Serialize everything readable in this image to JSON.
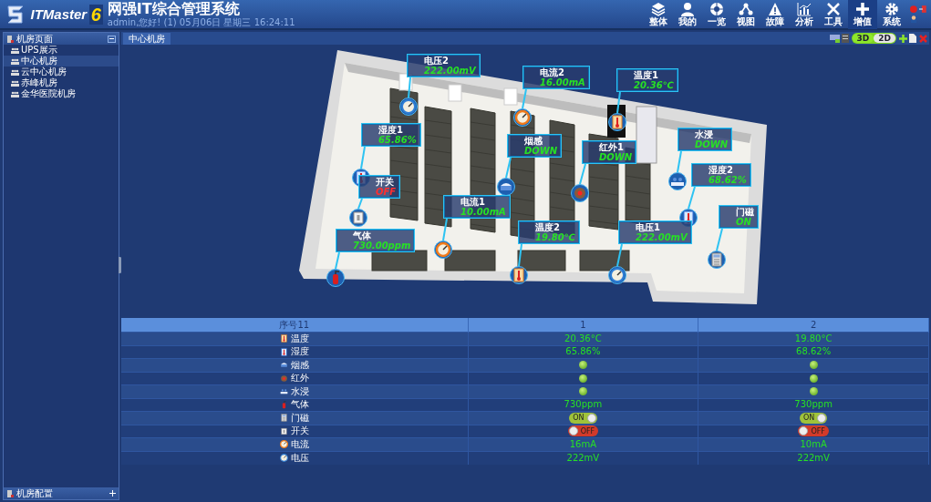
{
  "app": {
    "logo_text": "ITMaster",
    "logo_version": "6",
    "title": "网强IT综合管理系统",
    "user_line": "admin,您好! (1) 05月06日 星期三 16:24:11"
  },
  "nav": [
    {
      "label": "整体",
      "selected": false
    },
    {
      "label": "我的",
      "selected": false
    },
    {
      "label": "一览",
      "selected": false
    },
    {
      "label": "视图",
      "selected": false
    },
    {
      "label": "故障",
      "selected": false
    },
    {
      "label": "分析",
      "selected": false
    },
    {
      "label": "工具",
      "selected": false
    },
    {
      "label": "增值",
      "selected": true
    },
    {
      "label": "系统",
      "selected": false
    }
  ],
  "sidebar": {
    "title": "机房页面",
    "items": [
      {
        "label": "UPS展示",
        "selected": false
      },
      {
        "label": "中心机房",
        "selected": true
      },
      {
        "label": "云中心机房",
        "selected": false
      },
      {
        "label": "赤峰机房",
        "selected": false
      },
      {
        "label": "金华医院机房",
        "selected": false
      }
    ],
    "footer": "机房配置"
  },
  "tabs": [
    {
      "label": "中心机房",
      "selected": true
    }
  ],
  "view_toggle": [
    {
      "label": "3D",
      "selected": true
    },
    {
      "label": "2D",
      "selected": false
    }
  ],
  "sensors": [
    {
      "kind": "voltage",
      "name": "电压2",
      "value": "222.00mV",
      "alarm": false
    },
    {
      "kind": "current",
      "name": "电流2",
      "value": "16.00mA",
      "alarm": false
    },
    {
      "kind": "temperature",
      "name": "温度1",
      "value": "20.36℃",
      "alarm": false
    },
    {
      "kind": "humidity",
      "name": "湿度1",
      "value": "65.86%",
      "alarm": false
    },
    {
      "kind": "smoke",
      "name": "烟感",
      "value": "DOWN",
      "alarm": false
    },
    {
      "kind": "infrared",
      "name": "红外1",
      "value": "DOWN",
      "alarm": false
    },
    {
      "kind": "water",
      "name": "水浸",
      "value": "DOWN",
      "alarm": false
    },
    {
      "kind": "humidity",
      "name": "湿度2",
      "value": "68.62%",
      "alarm": false
    },
    {
      "kind": "switch",
      "name": "开关",
      "value": "OFF",
      "alarm": true
    },
    {
      "kind": "current",
      "name": "电流1",
      "value": "10.00mA",
      "alarm": false
    },
    {
      "kind": "gas",
      "name": "气体",
      "value": "730.00ppm",
      "alarm": false
    },
    {
      "kind": "temperature",
      "name": "温度2",
      "value": "19.80℃",
      "alarm": false
    },
    {
      "kind": "voltage",
      "name": "电压1",
      "value": "222.00mV",
      "alarm": false
    },
    {
      "kind": "door",
      "name": "门磁",
      "value": "ON",
      "alarm": false
    }
  ],
  "table": {
    "columns": [
      "序号11",
      "1",
      "2"
    ],
    "rows": [
      {
        "kind": "temperature",
        "cells": [
          {
            "kind": "label",
            "text": "温度"
          },
          {
            "kind": "text",
            "text": "20.36°C"
          },
          {
            "kind": "text",
            "text": "19.80°C"
          }
        ]
      },
      {
        "kind": "humidity",
        "cells": [
          {
            "kind": "label",
            "text": "湿度"
          },
          {
            "kind": "text",
            "text": "65.86%"
          },
          {
            "kind": "text",
            "text": "68.62%"
          }
        ]
      },
      {
        "kind": "smoke",
        "cells": [
          {
            "kind": "label",
            "text": "烟感"
          },
          {
            "kind": "led",
            "on": true
          },
          {
            "kind": "led",
            "on": true
          }
        ]
      },
      {
        "kind": "infrared",
        "cells": [
          {
            "kind": "label",
            "text": "红外"
          },
          {
            "kind": "led",
            "on": true
          },
          {
            "kind": "led",
            "on": true
          }
        ]
      },
      {
        "kind": "water",
        "cells": [
          {
            "kind": "label",
            "text": "水浸"
          },
          {
            "kind": "led",
            "on": true
          },
          {
            "kind": "led",
            "on": true
          }
        ]
      },
      {
        "kind": "gas",
        "cells": [
          {
            "kind": "label",
            "text": "气体"
          },
          {
            "kind": "text",
            "text": "730ppm"
          },
          {
            "kind": "text",
            "text": "730ppm"
          }
        ]
      },
      {
        "kind": "door",
        "cells": [
          {
            "kind": "label",
            "text": "门磁"
          },
          {
            "kind": "toggle",
            "on": true,
            "text": "ON"
          },
          {
            "kind": "toggle",
            "on": true,
            "text": "ON"
          }
        ]
      },
      {
        "kind": "switch",
        "cells": [
          {
            "kind": "label",
            "text": "开关"
          },
          {
            "kind": "toggle",
            "on": false,
            "text": "OFF"
          },
          {
            "kind": "toggle",
            "on": false,
            "text": "OFF"
          }
        ]
      },
      {
        "kind": "current",
        "cells": [
          {
            "kind": "label",
            "text": "电流"
          },
          {
            "kind": "text",
            "text": "16mA"
          },
          {
            "kind": "text",
            "text": "10mA"
          }
        ]
      },
      {
        "kind": "voltage",
        "cells": [
          {
            "kind": "label",
            "text": "电压"
          },
          {
            "kind": "text",
            "text": "222mV"
          },
          {
            "kind": "text",
            "text": "222mV"
          }
        ]
      }
    ]
  }
}
